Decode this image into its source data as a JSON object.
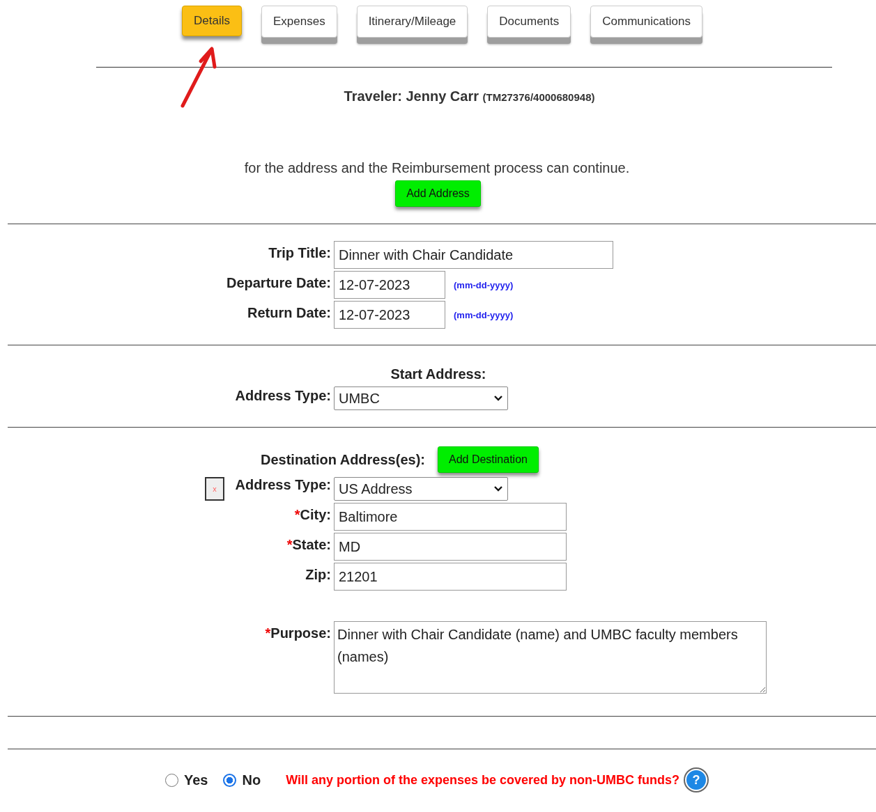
{
  "tabs": [
    {
      "label": "Details",
      "selected": true
    },
    {
      "label": "Expenses",
      "selected": false
    },
    {
      "label": "Itinerary/Mileage",
      "selected": false
    },
    {
      "label": "Documents",
      "selected": false
    },
    {
      "label": "Communications",
      "selected": false
    }
  ],
  "traveler": {
    "label": "Traveler: Jenny Carr",
    "id": "(TM27376/4000680948)"
  },
  "notice": {
    "text": "for the address and the Reimbursement process can continue.",
    "button": "Add Address"
  },
  "trip": [
    {
      "label": "Trip Title:",
      "value": "Dinner with Chair Candidate",
      "kind": "wide"
    },
    {
      "label": "Departure Date:",
      "value": "12-07-2023",
      "kind": "date",
      "hint": "(mm-dd-yyyy)"
    },
    {
      "label": "Return Date:",
      "value": "12-07-2023",
      "kind": "date",
      "hint": "(mm-dd-yyyy)"
    }
  ],
  "start_address": {
    "heading": "Start Address:",
    "type_label": "Address Type:",
    "type_value": "UMBC"
  },
  "destination": {
    "heading": "Destination Address(es):",
    "button": "Add Destination",
    "remove": "x",
    "type_label": "Address Type:",
    "type_value": "US Address",
    "fields": [
      {
        "label": "City:",
        "required_mark": "*",
        "value": "Baltimore"
      },
      {
        "label": "State:",
        "required_mark": "*",
        "value": "MD"
      },
      {
        "label": "Zip:",
        "value": "21201"
      }
    ]
  },
  "purpose": {
    "label": "Purpose:",
    "required_mark": "*",
    "value": "Dinner with Chair Candidate (name) and UMBC faculty members (names)"
  },
  "funding": {
    "options": [
      {
        "label": "Yes",
        "selected": false
      },
      {
        "label": "No",
        "selected": true
      }
    ],
    "question": "Will any portion of the expenses be covered by non-UMBC funds?",
    "help": "?"
  }
}
